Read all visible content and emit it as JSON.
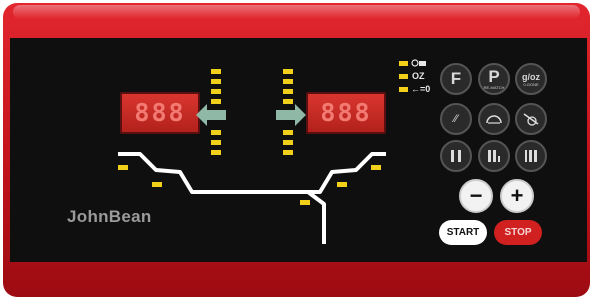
{
  "brand": {
    "logo": "JohnBean"
  },
  "displays": {
    "left_value": "888",
    "right_value": "888"
  },
  "units": {
    "oz_label": "OZ",
    "zero_label": "←=0"
  },
  "buttons": {
    "f": {
      "label": "F"
    },
    "p": {
      "label": "P",
      "sub": "RE-MATCH"
    },
    "g_oz": {
      "label": "g/oz",
      "sub": "0-GONE"
    },
    "minus": {
      "label": "−"
    },
    "plus": {
      "label": "+"
    },
    "start": {
      "label": "START"
    },
    "stop": {
      "label": "STOP"
    }
  },
  "icons": [
    "sensor-icon",
    "weight-unit-icon",
    "zero-arrow-icon",
    "balance-mode-icon",
    "split-weight-icon",
    "wheel-icon",
    "stick-on-icon",
    "rim-profile-icon",
    "rim-profile-2-icon",
    "rim-profile-3-icon",
    "arrow-left-icon",
    "arrow-right-icon"
  ],
  "colors": {
    "panel_red": "#d21c22",
    "display_red": "#c72a25",
    "led_yellow": "#f2d01a",
    "start_bg": "#ffffff",
    "stop_bg": "#d0201f"
  }
}
